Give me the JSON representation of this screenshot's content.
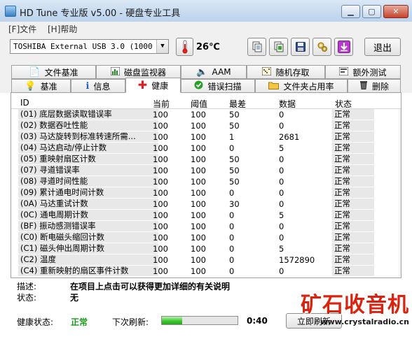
{
  "window": {
    "title": "HD Tune 专业版 v5.00 - 硬盘专业工具"
  },
  "menu": {
    "file": "[F]文件",
    "help": "[H]帮助"
  },
  "toolbar": {
    "drive": "TOSHIBA External USB 3.0 (1000 gB)",
    "temperature": "26℃",
    "exit": "退出",
    "icons": [
      "copy-text-icon",
      "copy-screen-icon",
      "save-icon",
      "options-icon",
      "download-icon"
    ]
  },
  "tabs": {
    "row1": [
      {
        "label": "文件基准",
        "icon": "file-benchmark-icon"
      },
      {
        "label": "磁盘监视器",
        "icon": "disk-monitor-icon"
      },
      {
        "label": "AAM",
        "icon": "speaker-icon"
      },
      {
        "label": "随机存取",
        "icon": "random-access-icon"
      },
      {
        "label": "额外测试",
        "icon": "extra-tests-icon"
      }
    ],
    "row2": [
      {
        "label": "基准",
        "icon": "benchmark-icon"
      },
      {
        "label": "信息",
        "icon": "info-icon"
      },
      {
        "label": "健康",
        "icon": "health-icon",
        "active": true
      },
      {
        "label": "错误扫描",
        "icon": "error-scan-icon"
      },
      {
        "label": "文件夹占用率",
        "icon": "folder-usage-icon"
      },
      {
        "label": "删除",
        "icon": "erase-icon"
      }
    ]
  },
  "table": {
    "columns": [
      "ID",
      "当前",
      "阈值",
      "最差",
      "数据",
      "状态"
    ],
    "rows": [
      {
        "id": "(01) 底层数据读取错误率",
        "current": "100",
        "threshold": "100",
        "worst": "50",
        "data": "0",
        "status": "正常"
      },
      {
        "id": "(02) 数据吞吐性能",
        "current": "100",
        "threshold": "100",
        "worst": "50",
        "data": "0",
        "status": "正常"
      },
      {
        "id": "(03) 马达旋转到标准转速所需...",
        "current": "100",
        "threshold": "100",
        "worst": "1",
        "data": "2681",
        "status": "正常"
      },
      {
        "id": "(04) 马达启动/停止计数",
        "current": "100",
        "threshold": "100",
        "worst": "0",
        "data": "5",
        "status": "正常"
      },
      {
        "id": "(05) 重映射扇区计数",
        "current": "100",
        "threshold": "100",
        "worst": "50",
        "data": "0",
        "status": "正常"
      },
      {
        "id": "(07) 寻道错误率",
        "current": "100",
        "threshold": "100",
        "worst": "50",
        "data": "0",
        "status": "正常"
      },
      {
        "id": "(08) 寻道时间性能",
        "current": "100",
        "threshold": "100",
        "worst": "50",
        "data": "0",
        "status": "正常"
      },
      {
        "id": "(09) 累计通电时间计数",
        "current": "100",
        "threshold": "100",
        "worst": "0",
        "data": "0",
        "status": "正常"
      },
      {
        "id": "(0A) 马达重试计数",
        "current": "100",
        "threshold": "100",
        "worst": "30",
        "data": "0",
        "status": "正常"
      },
      {
        "id": "(0C) 通电周期计数",
        "current": "100",
        "threshold": "100",
        "worst": "0",
        "data": "5",
        "status": "正常"
      },
      {
        "id": "(BF) 振动感测错误率",
        "current": "100",
        "threshold": "100",
        "worst": "0",
        "data": "0",
        "status": "正常"
      },
      {
        "id": "(C0) 断电磁头缩回计数",
        "current": "100",
        "threshold": "100",
        "worst": "0",
        "data": "0",
        "status": "正常"
      },
      {
        "id": "(C1) 磁头伸出周期计数",
        "current": "100",
        "threshold": "100",
        "worst": "0",
        "data": "5",
        "status": "正常"
      },
      {
        "id": "(C2) 温度",
        "current": "100",
        "threshold": "100",
        "worst": "0",
        "data": "1572890",
        "status": "正常"
      },
      {
        "id": "(C4) 重新映射的扇区事件计数",
        "current": "100",
        "threshold": "100",
        "worst": "0",
        "data": "0",
        "status": "正常"
      }
    ]
  },
  "details": {
    "desc_label": "描述:",
    "desc_text": "在项目上点击可以获得更加详细的有关说明",
    "status_label": "状态:",
    "status_text": "无"
  },
  "footer": {
    "health_label": "健康状态:",
    "health_value": "正常",
    "refresh_label": "下次刷新:",
    "refresh_progress": 0.27,
    "refresh_time": "0:40",
    "refresh_button": "立即刷新"
  },
  "watermark": {
    "text_cn": "矿石收音机",
    "url": "www.crystalradio.cn"
  },
  "colors": {
    "health_ok": "#1f9a1f",
    "watermark": "#d9230f",
    "thermo": "#e02020"
  }
}
